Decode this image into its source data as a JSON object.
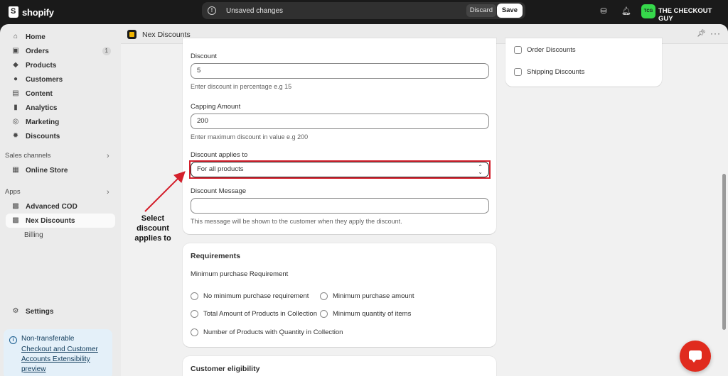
{
  "topbar": {
    "brand": "shopify",
    "unsaved_message": "Unsaved changes",
    "discard_label": "Discard",
    "save_label": "Save",
    "store_initials": "TCG",
    "store_name": "THE CHECKOUT GUY"
  },
  "sidebar": {
    "items": [
      {
        "label": "Home",
        "icon": "home-icon"
      },
      {
        "label": "Orders",
        "icon": "orders-icon",
        "badge": "1"
      },
      {
        "label": "Products",
        "icon": "tag-icon"
      },
      {
        "label": "Customers",
        "icon": "person-icon"
      },
      {
        "label": "Content",
        "icon": "content-icon"
      },
      {
        "label": "Analytics",
        "icon": "chart-bar-icon"
      },
      {
        "label": "Marketing",
        "icon": "target-icon"
      },
      {
        "label": "Discounts",
        "icon": "discount-icon"
      }
    ],
    "sales_channels_title": "Sales channels",
    "online_store_label": "Online Store",
    "apps_title": "Apps",
    "apps": [
      {
        "label": "Advanced COD"
      },
      {
        "label": "Nex Discounts"
      }
    ],
    "billing_label": "Billing",
    "settings_label": "Settings",
    "notice": {
      "title": "Non-transferable",
      "link": "Checkout and Customer Accounts Extensibility preview"
    }
  },
  "app": {
    "title": "Nex Discounts"
  },
  "form": {
    "discount_label": "Discount",
    "discount_value": "5",
    "discount_help": "Enter discount in percentage e.g 15",
    "capping_label": "Capping Amount",
    "capping_value": "200",
    "capping_help": "Enter maximum discount in value e.g 200",
    "applies_label": "Discount applies to",
    "applies_value": "For all products",
    "message_label": "Discount Message",
    "message_value": "",
    "message_help": "This message will be shown to the customer when they apply the discount."
  },
  "discount_types": {
    "order": "Order Discounts",
    "shipping": "Shipping Discounts"
  },
  "requirements": {
    "title": "Requirements",
    "subtitle": "Minimum purchase Requirement",
    "options": [
      "No minimum purchase requirement",
      "Minimum purchase amount",
      "Total Amount of Products in Collection",
      "Minimum quantity of items",
      "Number of Products with Quantity in Collection"
    ]
  },
  "eligibility": {
    "title": "Customer eligibility"
  },
  "annotation": {
    "text": "Select discount applies to",
    "color": "#d4202c"
  }
}
